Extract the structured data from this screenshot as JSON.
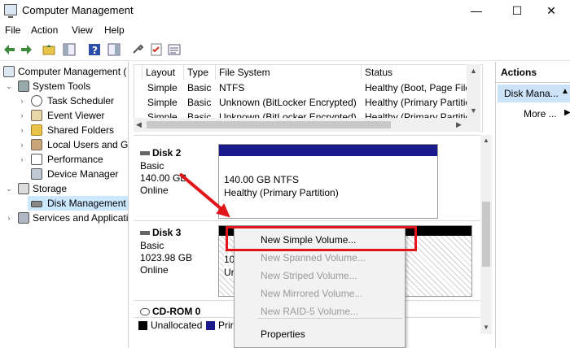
{
  "window": {
    "title": "Computer Management",
    "minimize": "—",
    "maximize": "☐",
    "close": "✕"
  },
  "menu": [
    "File",
    "Action",
    "View",
    "Help"
  ],
  "toolbar": {
    "back": "back-arrow",
    "forward": "forward-arrow"
  },
  "tree": {
    "root": "Computer Management (",
    "system_tools": "System Tools",
    "task_scheduler": "Task Scheduler",
    "event_viewer": "Event Viewer",
    "shared_folders": "Shared Folders",
    "local_users": "Local Users and Gr",
    "performance": "Performance",
    "device_manager": "Device Manager",
    "storage": "Storage",
    "disk_management": "Disk Management",
    "services": "Services and Applicatio"
  },
  "list": {
    "columns": [
      "Layout",
      "Type",
      "File System",
      "Status"
    ],
    "rows": [
      [
        "Simple",
        "Basic",
        "NTFS",
        "Healthy (Boot, Page File, C"
      ],
      [
        "Simple",
        "Basic",
        "Unknown (BitLocker Encrypted)",
        "Healthy (Primary Partition)"
      ],
      [
        "Simple",
        "Basic",
        "Unknown (BitLocker Encrypted)",
        "Healthy (Primary Partition)"
      ]
    ]
  },
  "disks": {
    "disk2": {
      "name": "Disk 2",
      "type": "Basic",
      "size": "140.00 GB",
      "status": "Online",
      "volume_size": "140.00 GB NTFS",
      "volume_status": "Healthy (Primary Partition)"
    },
    "disk3": {
      "name": "Disk 3",
      "type": "Basic",
      "size": "1023.98 GB",
      "status": "Online",
      "volume_line1": "10",
      "volume_line2": "Ur"
    },
    "cdrom": {
      "name": "CD-ROM 0"
    }
  },
  "legend": {
    "unallocated": "Unallocated",
    "primary": "Prir"
  },
  "actions": {
    "header": "Actions",
    "selected": "Disk Mana...",
    "more": "More ..."
  },
  "context_menu": {
    "items": [
      {
        "label": "New Simple Volume...",
        "enabled": true
      },
      {
        "label": "New Spanned Volume...",
        "enabled": false
      },
      {
        "label": "New Striped Volume...",
        "enabled": false
      },
      {
        "label": "New Mirrored Volume...",
        "enabled": false
      },
      {
        "label": "New RAID-5 Volume...",
        "enabled": false
      }
    ],
    "properties": "Properties"
  },
  "colors": {
    "accent_blue": "#1a1a8c",
    "highlight_red": "#e0161b",
    "selected_bg": "#cce8ff"
  }
}
